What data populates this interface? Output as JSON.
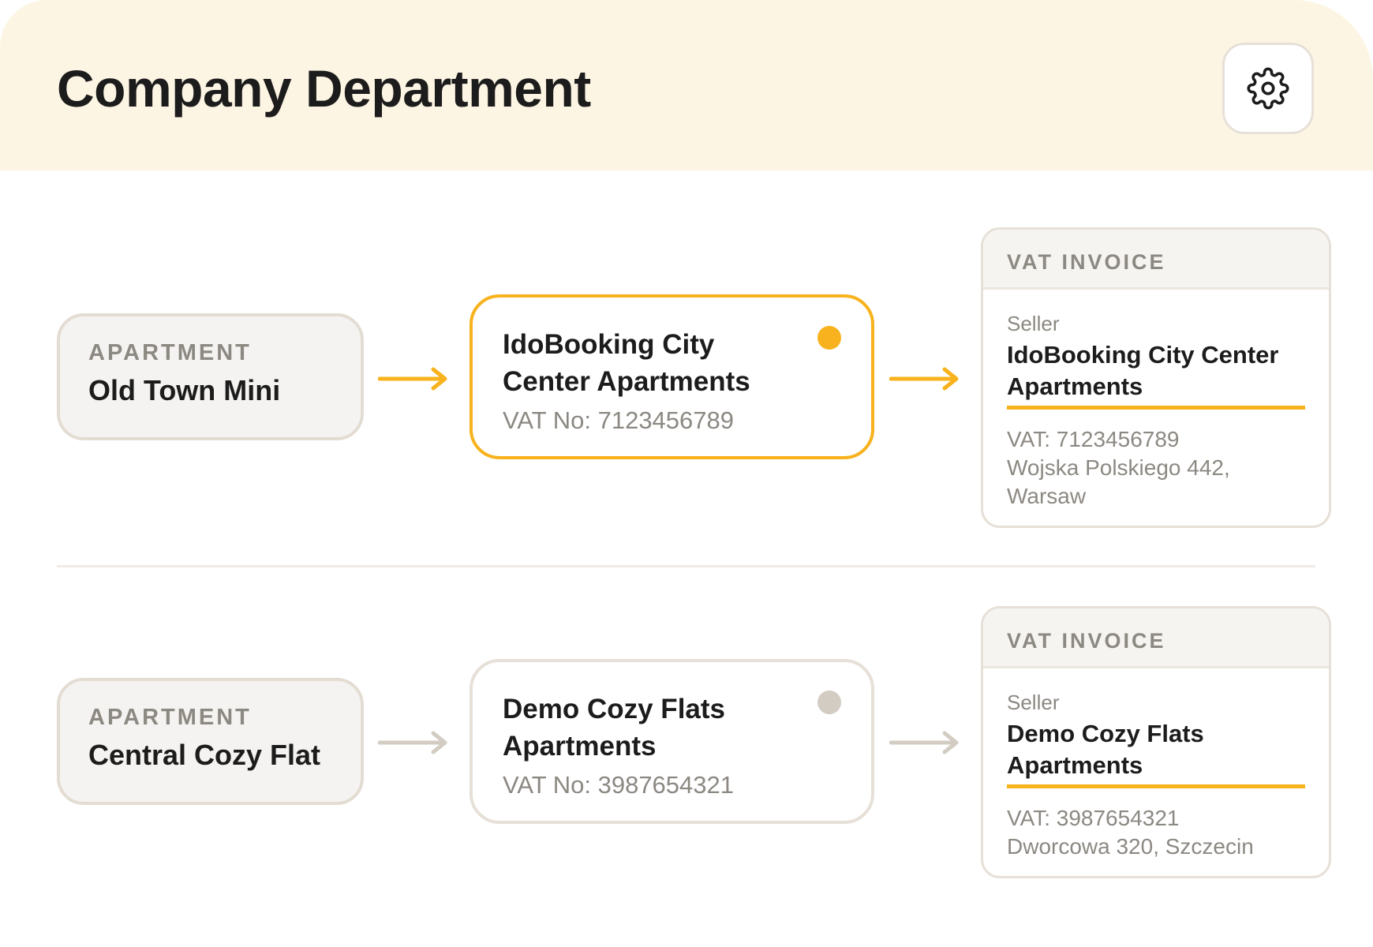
{
  "header": {
    "title": "Company Department",
    "settings_icon": "gear-icon"
  },
  "colors": {
    "header_bg": "#fdf5e3",
    "accent": "#f8b21d",
    "inactive": "#d3ccc3",
    "text_dark": "#1c1c1c",
    "text_muted": "#8c8882"
  },
  "rows": [
    {
      "apartment": {
        "label": "APARTMENT",
        "name": "Old Town Mini"
      },
      "company": {
        "name": "IdoBooking City Center Apartments",
        "vat": "VAT No: 7123456789",
        "active": true
      },
      "invoice": {
        "heading": "VAT INVOICE",
        "seller_label": "Seller",
        "seller_name": "IdoBooking City Center Apartments",
        "vat": "VAT: 7123456789",
        "address": "Wojska Polskiego 442, Warsaw"
      }
    },
    {
      "apartment": {
        "label": "APARTMENT",
        "name": "Central Cozy Flat"
      },
      "company": {
        "name": "Demo Cozy Flats Apartments",
        "vat": "VAT No: 3987654321",
        "active": false
      },
      "invoice": {
        "heading": "VAT INVOICE",
        "seller_label": "Seller",
        "seller_name": "Demo Cozy Flats Apartments",
        "vat": "VAT: 3987654321",
        "address": "Dworcowa 320, Szczecin"
      }
    }
  ]
}
